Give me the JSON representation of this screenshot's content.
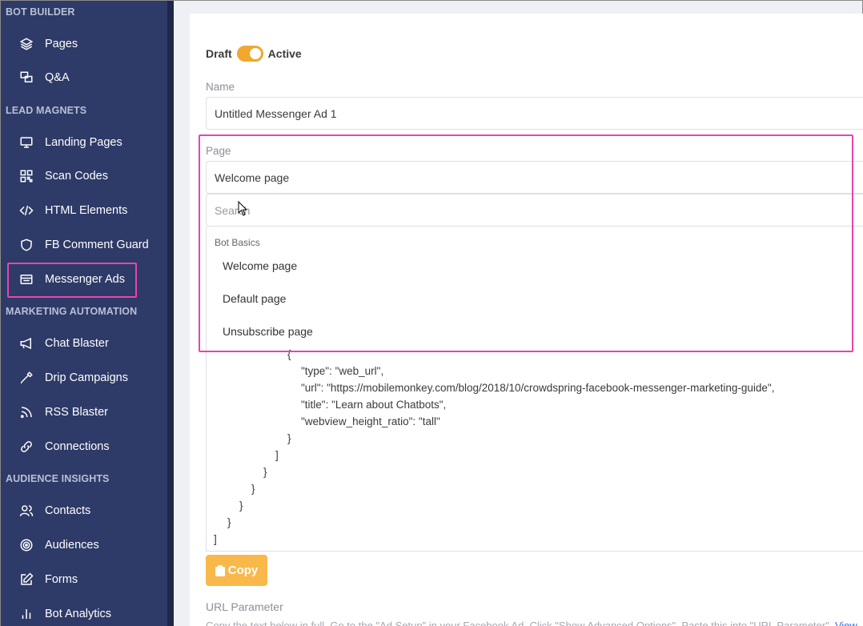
{
  "sidebar": {
    "sections": [
      {
        "title": "BOT BUILDER"
      },
      {
        "title": "LEAD MAGNETS"
      },
      {
        "title": "MARKETING AUTOMATION"
      },
      {
        "title": "AUDIENCE INSIGHTS"
      }
    ],
    "items": [
      {
        "label": "Pages",
        "icon": "layers-icon"
      },
      {
        "label": "Q&A",
        "icon": "qa-icon"
      },
      {
        "label": "Landing Pages",
        "icon": "monitor-icon"
      },
      {
        "label": "Scan Codes",
        "icon": "qr-code-icon"
      },
      {
        "label": "HTML Elements",
        "icon": "code-icon"
      },
      {
        "label": "FB Comment Guard",
        "icon": "shield-icon"
      },
      {
        "label": "Messenger Ads",
        "icon": "ad-icon",
        "active": true
      },
      {
        "label": "Chat Blaster",
        "icon": "megaphone-icon"
      },
      {
        "label": "Drip Campaigns",
        "icon": "dropper-icon"
      },
      {
        "label": "RSS Blaster",
        "icon": "rss-icon"
      },
      {
        "label": "Connections",
        "icon": "link-icon"
      },
      {
        "label": "Contacts",
        "icon": "users-icon"
      },
      {
        "label": "Audiences",
        "icon": "target-icon"
      },
      {
        "label": "Forms",
        "icon": "edit-icon"
      },
      {
        "label": "Bot Analytics",
        "icon": "bar-chart-icon"
      }
    ]
  },
  "form": {
    "status_draft": "Draft",
    "status_active": "Active",
    "name_label": "Name",
    "name_value": "Untitled Messenger Ad 1",
    "page_label": "Page",
    "page_value": "Welcome page",
    "search_placeholder": "Search",
    "group_label": "Bot Basics",
    "options": [
      "Welcome page",
      "Default page",
      "Unsubscribe page"
    ],
    "code_lines": [
      "{",
      "\"type\": \"web_url\",",
      "\"url\": \"https://mobilemonkey.com/blog/2018/10/crowdspring-facebook-messenger-marketing-guide\",",
      "\"title\": \"Learn about Chatbots\",",
      "\"webview_height_ratio\": \"tall\"",
      "}",
      "]",
      "}",
      "}",
      "}",
      "}",
      "]"
    ],
    "copy_label": "Copy",
    "url_param_label": "URL Parameter",
    "url_param_hint": "Copy the text below in full. Go to the \"Ad Setup\" in your Facebook Ad. Click \"Show Advanced Options\". Paste this into \"URL Parameter\".",
    "view_link": "View"
  },
  "colors": {
    "sidebar_bg": "#2e3a67",
    "accent": "#f0a830",
    "highlight": "#e844b2"
  }
}
